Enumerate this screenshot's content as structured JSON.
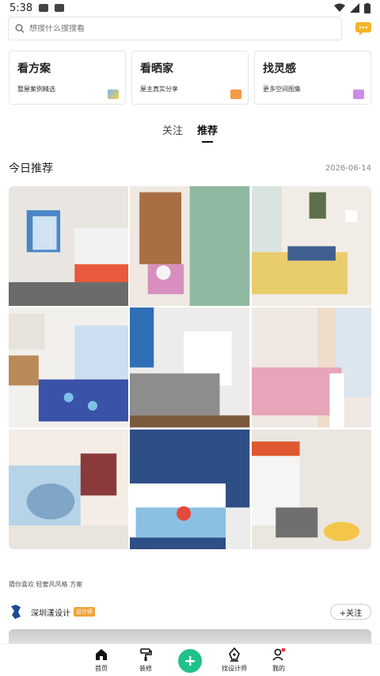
{
  "status_bar": {
    "time": "5:38"
  },
  "search": {
    "placeholder": "想搜什么搜搜看"
  },
  "cards": [
    {
      "title": "看方案",
      "subtitle": "整屋案例精选",
      "icon": "case-icon",
      "icon_color": "#7ab3f5"
    },
    {
      "title": "看晒家",
      "subtitle": "屋主真实分享",
      "icon": "sofa-icon",
      "icon_color": "#f59a45"
    },
    {
      "title": "找灵感",
      "subtitle": "更多空间图集",
      "icon": "mail-icon",
      "icon_color": "#c98ce8"
    }
  ],
  "tabs": [
    {
      "label": "关注",
      "active": false
    },
    {
      "label": "推荐",
      "active": true
    }
  ],
  "today": {
    "title": "今日推荐",
    "date": "2026-06-14"
  },
  "recommend_label": "猜你喜欢 轻奢风风格 方案",
  "designer": {
    "name": "深圳漾设计",
    "badge": "设计师",
    "follow_label": "+关注"
  },
  "bottom_nav": [
    {
      "label": "首页",
      "icon": "home-icon"
    },
    {
      "label": "装修",
      "icon": "paint-roller-icon"
    },
    {
      "label": "",
      "icon": "plus-icon"
    },
    {
      "label": "找设计师",
      "icon": "pen-nib-icon"
    },
    {
      "label": "我的",
      "icon": "user-icon"
    }
  ],
  "colors": {
    "accent": "#20c28a",
    "badge": "#f0a33c",
    "chat": "#f5b325"
  }
}
